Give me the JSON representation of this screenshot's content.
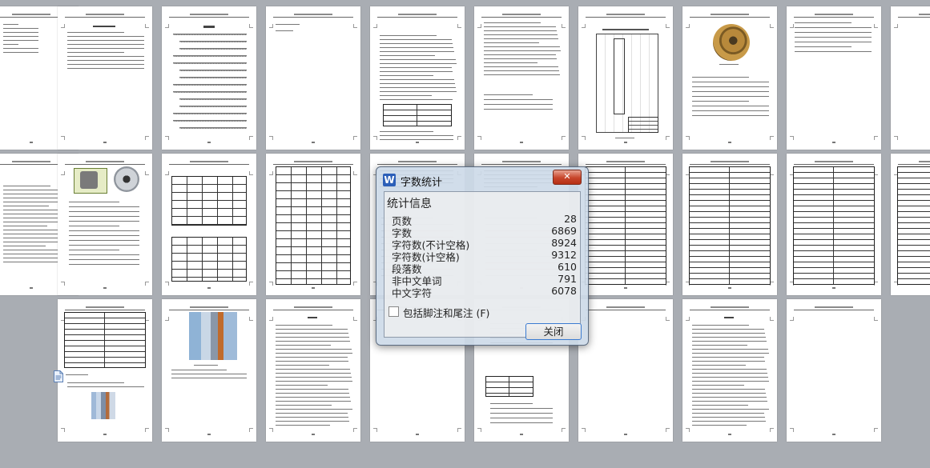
{
  "dialog": {
    "app_icon_letter": "W",
    "title": "字数统计",
    "close_glyph": "✕",
    "group_label": "统计信息",
    "stats": [
      {
        "label": "页数",
        "value": "28"
      },
      {
        "label": "字数",
        "value": "6869"
      },
      {
        "label": "字符数(不计空格)",
        "value": "8924"
      },
      {
        "label": "字符数(计空格)",
        "value": "9312"
      },
      {
        "label": "段落数",
        "value": "610"
      },
      {
        "label": "非中文单词",
        "value": "791"
      },
      {
        "label": "中文字符",
        "value": "6078"
      }
    ],
    "include_footnotes_label": "包括脚注和尾注 (F)",
    "include_footnotes_checked": false,
    "close_button_label": "关闭"
  },
  "colors": {
    "workspace_bg": "#a9adb3",
    "dialog_frame": "#cddae8",
    "close_button": "#c7452b",
    "accent_blue": "#2c5fb8"
  },
  "icons": {
    "app_icon": "wps-writer-icon",
    "window_close": "close-icon",
    "side_document": "document-icon"
  }
}
